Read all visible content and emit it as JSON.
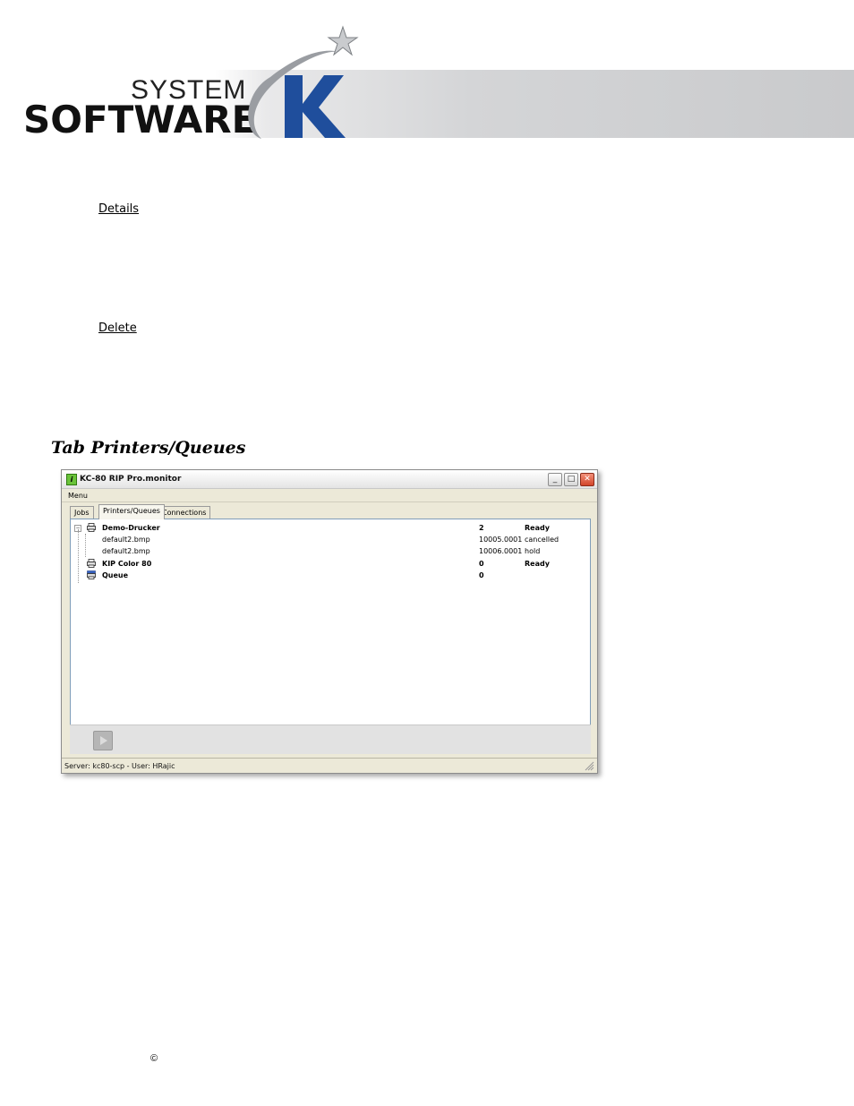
{
  "header": {
    "logo_system": "SYSTEM",
    "logo_software": "SOFTWARE",
    "logo_k": "K"
  },
  "links": {
    "details": "Details",
    "delete": "Delete"
  },
  "section_title": "Tab Printers/Queues",
  "window": {
    "title": "KC-80 RIP Pro.monitor",
    "app_icon_letter": "i",
    "controls": {
      "minimize": "_",
      "maximize": "□",
      "close": "✕"
    },
    "menu": "Menu",
    "tabs": [
      {
        "label": "Jobs",
        "active": false
      },
      {
        "label": "Printers/Queues",
        "active": true
      },
      {
        "label": "Connections",
        "active": false
      }
    ],
    "rows": [
      {
        "name": "Demo-Drucker",
        "value": "2",
        "status": "Ready",
        "bold": true,
        "icon": "printer-icon",
        "expander": "−"
      },
      {
        "name": "default2.bmp",
        "value": "10005.0001",
        "status": "cancelled",
        "bold": false,
        "icon": ""
      },
      {
        "name": "default2.bmp",
        "value": "10006.0001",
        "status": "hold",
        "bold": false,
        "icon": ""
      },
      {
        "name": "KIP Color 80",
        "value": "0",
        "status": "Ready",
        "bold": true,
        "icon": "printer-icon"
      },
      {
        "name": "Queue",
        "value": "0",
        "status": "",
        "bold": true,
        "icon": "queue-icon"
      }
    ],
    "status_bar": "Server: kc80-scp - User: HRajic"
  },
  "footer": {
    "copyright": "©"
  },
  "colors": {
    "logo_blue": "#1f4e9c",
    "title_icon_green": "#6ac33a",
    "close_red": "#d2452a"
  }
}
